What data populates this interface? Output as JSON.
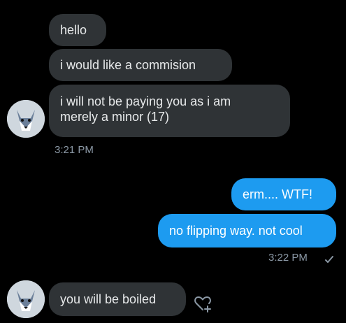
{
  "conversation": {
    "incoming_group_1": {
      "messages": [
        "hello",
        "i would like a commision",
        "i will not be paying you as i am\nmerely a minor (17)"
      ],
      "timestamp": "3:21 PM"
    },
    "outgoing_group": {
      "messages": [
        "erm.... WTF!",
        "no flipping way. not cool"
      ],
      "timestamp": "3:22 PM",
      "status_icon": "checkmark-icon"
    },
    "incoming_group_2": {
      "messages": [
        "you will be boiled"
      ],
      "reaction_icon": "add-reaction-heart-icon"
    }
  },
  "colors": {
    "background": "#000000",
    "incoming_bubble": "#2f3336",
    "outgoing_bubble": "#1d9bf0",
    "timestamp": "#8b98a5"
  }
}
